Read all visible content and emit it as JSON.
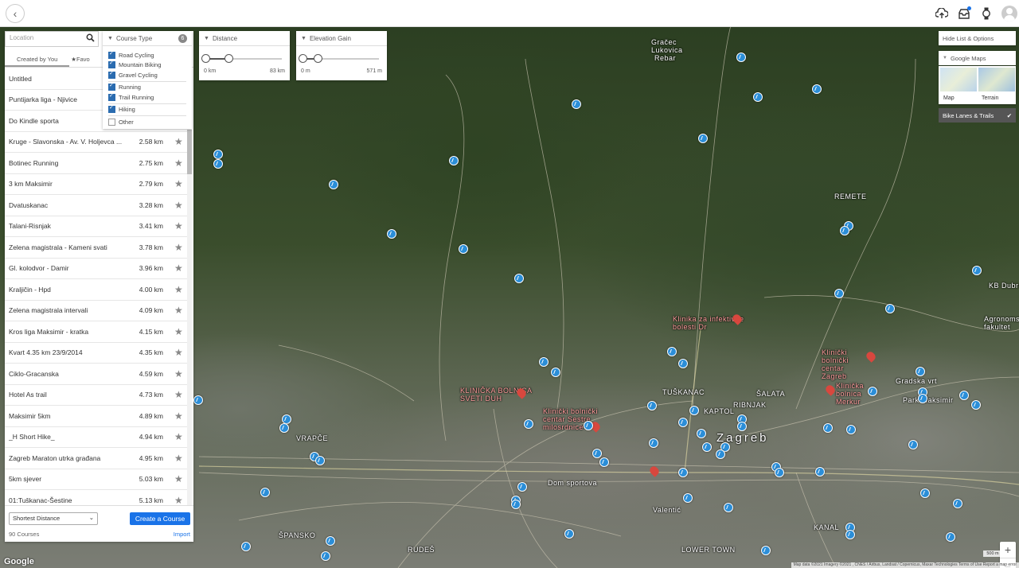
{
  "app": {
    "back_icon": "chevron-left-icon",
    "top_icons": [
      "upload-cloud-icon",
      "inbox-icon",
      "watch-icon",
      "avatar-icon"
    ]
  },
  "search": {
    "placeholder": "Location"
  },
  "tabs": [
    {
      "label": "Created by You"
    },
    {
      "label": "Favo"
    }
  ],
  "courses": [
    {
      "name": "Untitled",
      "distance": ""
    },
    {
      "name": "Puntijarka liga - Njivice",
      "distance": ""
    },
    {
      "name": "Do Kindle sporta",
      "distance": ""
    },
    {
      "name": "Kruge - Slavonska - Av. V. Holjevca ...",
      "distance": "2.58 km"
    },
    {
      "name": "Botinec Running",
      "distance": "2.75 km"
    },
    {
      "name": "3 km Maksimir",
      "distance": "2.79 km"
    },
    {
      "name": "Dvatuskanac",
      "distance": "3.28 km"
    },
    {
      "name": "Talani-Risnjak",
      "distance": "3.41 km"
    },
    {
      "name": "Zelena magistrala - Kameni svati",
      "distance": "3.78 km"
    },
    {
      "name": "Gl. kolodvor - Damir",
      "distance": "3.96 km"
    },
    {
      "name": "Kraljičin - Hpd",
      "distance": "4.00 km"
    },
    {
      "name": "Zelena magistrala intervali",
      "distance": "4.09 km"
    },
    {
      "name": "Kros liga Maksimir - kratka",
      "distance": "4.15 km"
    },
    {
      "name": "Kvart 4.35 km 23/9/2014",
      "distance": "4.35 km"
    },
    {
      "name": "Ciklo-Gracanska",
      "distance": "4.59 km"
    },
    {
      "name": "Hotel As trail",
      "distance": "4.73 km"
    },
    {
      "name": "Maksimir 5km",
      "distance": "4.89 km"
    },
    {
      "name": "_H Short Hike_",
      "distance": "4.94 km"
    },
    {
      "name": "Zagreb Maraton utrka građana",
      "distance": "4.95 km"
    },
    {
      "name": "5km sjever",
      "distance": "5.03 km"
    },
    {
      "name": "01:Tuškanac-Šestine",
      "distance": "5.13 km"
    }
  ],
  "bottom": {
    "sort_value": "Shortest Distance",
    "create_label": "Create a Course",
    "count_label": "90 Courses",
    "import_label": "Import"
  },
  "course_type": {
    "title": "Course Type",
    "count": "6",
    "options": [
      {
        "label": "Road Cycling",
        "checked": true
      },
      {
        "label": "Mountain Biking",
        "checked": true
      },
      {
        "label": "Gravel Cycling",
        "checked": true
      },
      {
        "label": "Running",
        "checked": true
      },
      {
        "label": "Trail Running",
        "checked": true
      },
      {
        "label": "Hiking",
        "checked": true
      },
      {
        "label": "Other",
        "checked": false
      }
    ]
  },
  "distance": {
    "title": "Distance",
    "min": "0 km",
    "max": "83 km",
    "low_fraction": 0.0,
    "high_fraction": 0.3
  },
  "elevation": {
    "title": "Elevation Gain",
    "min": "0 m",
    "max": "571 m",
    "low_fraction": 0.0,
    "high_fraction": 0.2
  },
  "right_panel": {
    "hide_label": "Hide List & Options",
    "google_maps_label": "Google Maps",
    "map_label": "Map",
    "terrain_label": "Terrain",
    "bike_label": "Bike Lanes & Trails"
  },
  "map": {
    "labels": {
      "gracec": "Gračec",
      "lukovica": "Lukovica",
      "rebar": "Rebar",
      "remete": "REMETE",
      "tuskanac": "TUŠKANAC",
      "ribnjak": "RIBNJAK",
      "salata": "ŠALATA",
      "kaptol": "KAPTOL",
      "zagreb": "Zagreb",
      "vrapce": "VRAPČE",
      "spansko": "ŠPANSKO",
      "rudes": "RUDEŠ",
      "lower_town": "LOWER TOWN",
      "kanal": "KANAL",
      "valentic": "Valentić",
      "dom_sportova": "Dom sportova",
      "klinika_inf": "Klinika za infektivne bolesti Dr",
      "klinicki_centar": "Klinički bolnički centar Zagreb",
      "klinicka_bolnica": "KLINIČKA BOLNICA SVETI DUH",
      "sestre": "Klinički bolnički centar Sestre milosrdnice",
      "kbc_merkur": "Klinička bolnica Merkur",
      "agronomski": "Agronomski fakultet",
      "kbdubrava": "KB Dubrava",
      "park_maksimir": "Park Maksimir",
      "gradska": "Gradska vrt"
    },
    "zoom_in": "+",
    "zoom_out": "−",
    "scale": "500 m",
    "google": "Google",
    "attribution": "Map data ©2021 Imagery ©2021 , CNES / Airbus, Landsat / Copernicus, Maxar Technologies   Terms of Use   Report a map error"
  }
}
